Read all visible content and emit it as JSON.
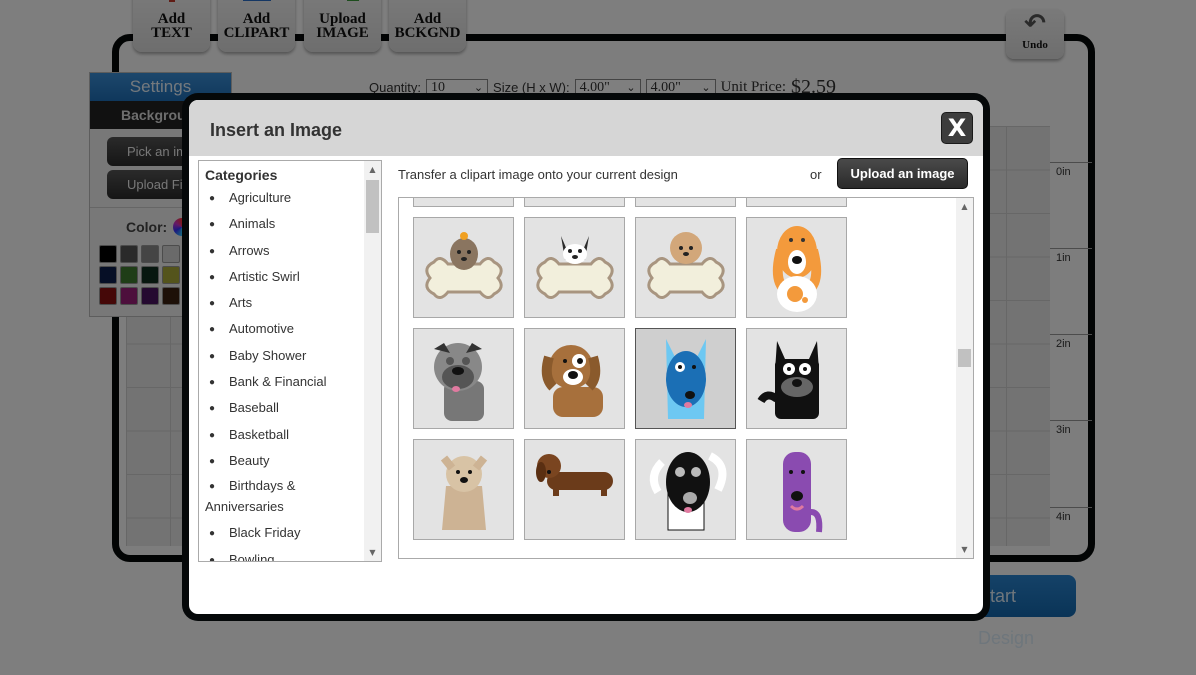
{
  "toolbar": {
    "buttons": [
      {
        "label_line1": "Add",
        "label_line2": "TEXT",
        "icon": "text-icon"
      },
      {
        "label_line1": "Add",
        "label_line2": "CLIPART",
        "icon": "clipart-icon"
      },
      {
        "label_line1": "Upload",
        "label_line2": "IMAGE",
        "icon": "photo-icon"
      },
      {
        "label_line1": "Add",
        "label_line2": "BCKGND",
        "icon": "background-icon"
      }
    ],
    "undo_label": "Undo"
  },
  "options": {
    "quantity_label": "Quantity:",
    "quantity_value": "10",
    "size_label": "Size (H x W):",
    "height_value": "4.00\"",
    "width_value": "4.00\"",
    "unit_price_label": "Unit Price:",
    "unit_price": "$2.59"
  },
  "settings_panel": {
    "tab_label": "Settings",
    "section_label": "Background",
    "pick_image_label": "Pick an image",
    "upload_file_label": "Upload File",
    "color_label": "Color:",
    "swatches": [
      "#000000",
      "#555555",
      "#8a8a8a",
      "#d4d4d4",
      "#1a1a6e",
      "#ffffff",
      "#0d1f4d",
      "#3e7a2e",
      "#0f2e1f",
      "#a8a838",
      "#c98a1a",
      "#ffffff",
      "#8a1010",
      "#9a1e78",
      "#4a1460",
      "#3a2010",
      "#888888",
      "#ffffff"
    ]
  },
  "ruler": [
    "0in",
    "1in",
    "2in",
    "3in",
    "4in"
  ],
  "start_design_label": "Start Design",
  "modal": {
    "title": "Insert an Image",
    "close_label": "X",
    "transfer_text": "Transfer a clipart image onto your current design",
    "or_text": "or",
    "upload_button": "Upload an image",
    "categories_heading": "Categories",
    "categories": [
      "Agriculture",
      "Animals",
      "Arrows",
      "Artistic Swirl",
      "Arts",
      "Automotive",
      "Baby Shower",
      "Bank & Financial",
      "Baseball",
      "Basketball",
      "Beauty",
      "Birthdays & Anniversaries",
      "Black Friday",
      "Bowling"
    ],
    "gallery": [
      {
        "name": "partial-clipart-1"
      },
      {
        "name": "partial-clipart-2"
      },
      {
        "name": "partial-clipart-3"
      },
      {
        "name": "partial-clipart-4"
      },
      {
        "name": "yorkie-bone-clipart"
      },
      {
        "name": "french-bulldog-bone-clipart"
      },
      {
        "name": "fluffy-puppy-bone-clipart"
      },
      {
        "name": "orange-basset-hound-clipart"
      },
      {
        "name": "gray-pug-clipart"
      },
      {
        "name": "brown-spotted-puppy-clipart"
      },
      {
        "name": "blue-dog-clipart",
        "selected": true
      },
      {
        "name": "black-scottie-clipart"
      },
      {
        "name": "tan-terrier-clipart"
      },
      {
        "name": "dachshund-clipart"
      },
      {
        "name": "black-white-dog-clipart"
      },
      {
        "name": "purple-dog-clipart"
      }
    ],
    "colors": {
      "close_bg": "#3d3d3d",
      "upload_bg": "#333333",
      "header_bg": "#d6d6d6"
    }
  }
}
